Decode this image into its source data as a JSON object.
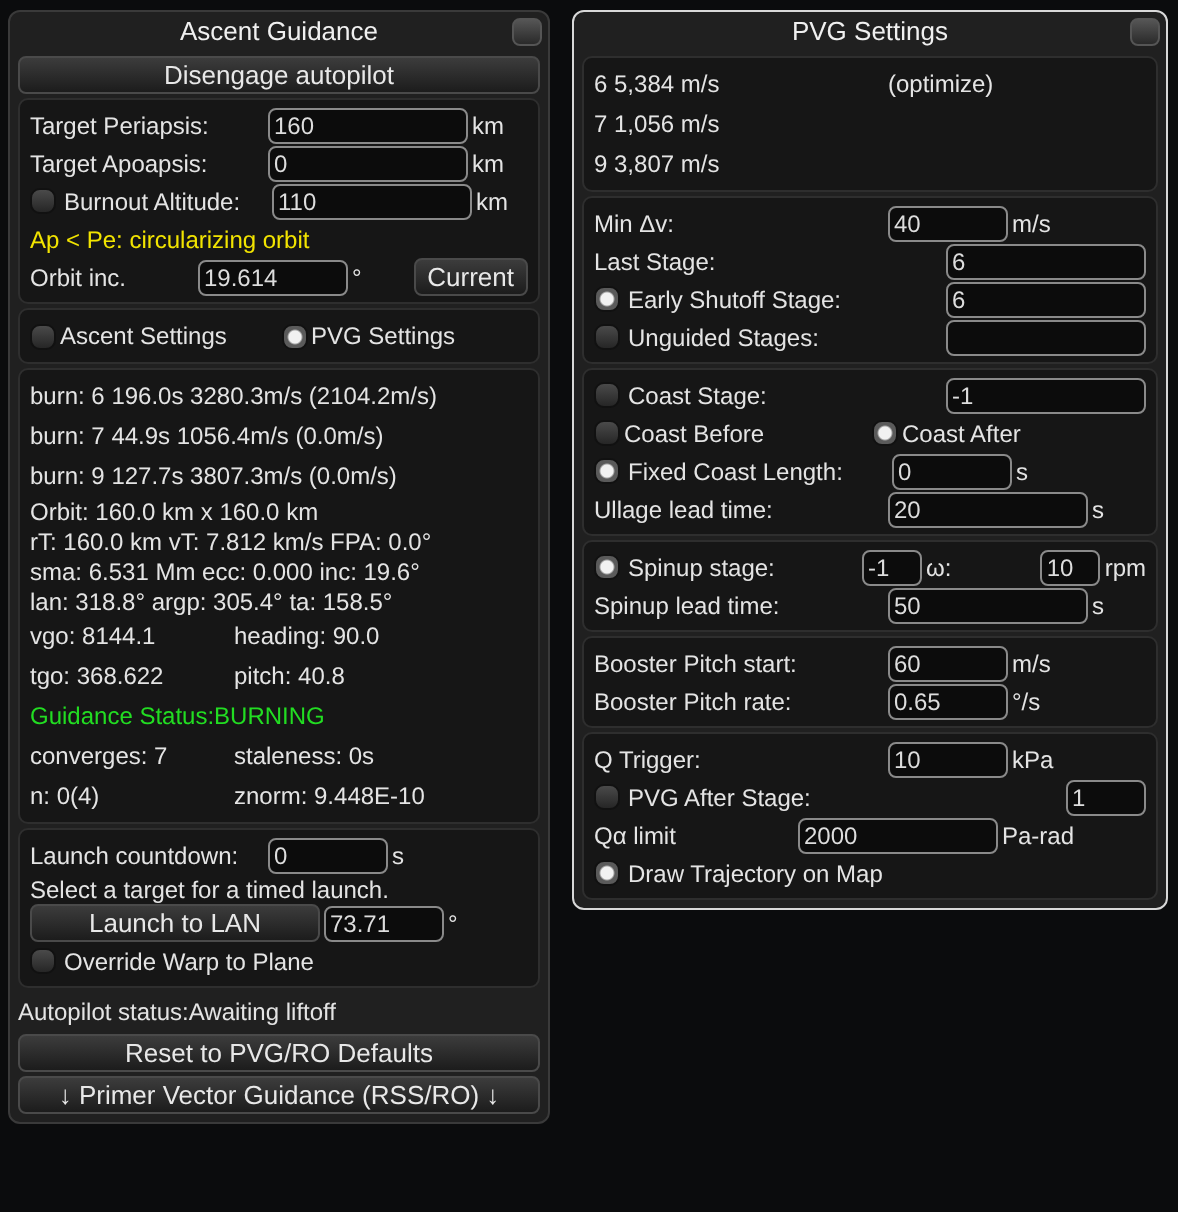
{
  "windows": [
    {
      "title": "Ascent Guidance",
      "blocks": [
        {
          "kind": "button",
          "label": "Disengage autopilot"
        },
        {
          "kind": "panel",
          "rows": [
            {
              "kind": "field",
              "label": "Target Periapsis:",
              "value": "160",
              "unit": "km"
            },
            {
              "kind": "field",
              "label": "Target Apoapsis:",
              "value": "0",
              "unit": "km"
            },
            {
              "kind": "field",
              "label": "Burnout Altitude:",
              "checked": false,
              "value": "110",
              "unit": "km"
            },
            {
              "kind": "warning",
              "text": "Ap < Pe: circularizing orbit"
            },
            {
              "kind": "field_button",
              "label": "Orbit inc.",
              "value": "19.614",
              "unit": "°",
              "button": "Current"
            }
          ]
        },
        {
          "kind": "panel",
          "rows": [
            {
              "kind": "tabs",
              "options": [
                {
                  "label": "Ascent Settings",
                  "selected": false
                },
                {
                  "label": "PVG Settings",
                  "selected": true
                }
              ]
            }
          ]
        },
        {
          "kind": "panel",
          "rows": [
            {
              "kind": "spaced",
              "text": "burn: 6 196.0s 3280.3m/s (2104.2m/s)"
            },
            {
              "kind": "spaced",
              "text": "burn: 7 44.9s 1056.4m/s (0.0m/s)"
            },
            {
              "kind": "spaced",
              "text": "burn: 9 127.7s 3807.3m/s (0.0m/s)"
            },
            {
              "kind": "text",
              "text": "Orbit: 160.0 km x 160.0 km"
            },
            {
              "kind": "text",
              "text": "rT: 160.0 km vT: 7.812 km/s FPA: 0.0°"
            },
            {
              "kind": "text",
              "text": "sma: 6.531 Mm ecc: 0.000 inc: 19.6°"
            },
            {
              "kind": "text",
              "text": "lan: 318.8° argp: 305.4° ta: 158.5°"
            },
            {
              "kind": "pair",
              "left": "vgo: 8144.1",
              "right": "heading: 90.0"
            },
            {
              "kind": "pair",
              "left": "tgo: 368.622",
              "right": "pitch: 40.8"
            },
            {
              "kind": "status",
              "text": "Guidance Status:BURNING"
            },
            {
              "kind": "pair",
              "left": "converges: 7",
              "right": "staleness: 0s"
            },
            {
              "kind": "pair",
              "left": "n: 0(4)",
              "right": "znorm: 9.448E-10"
            }
          ]
        },
        {
          "kind": "panel",
          "rows": [
            {
              "kind": "field_short",
              "label": "Launch countdown:",
              "value": "0",
              "unit": "s"
            },
            {
              "kind": "text",
              "text": "Select a target for a timed launch."
            },
            {
              "kind": "button_field",
              "button": "Launch to LAN",
              "value": "73.71",
              "unit": "°"
            },
            {
              "kind": "toggle",
              "label": "Override Warp to Plane",
              "checked": false
            }
          ]
        },
        {
          "kind": "text",
          "text": "Autopilot status:Awaiting liftoff"
        },
        {
          "kind": "button",
          "label": "Reset to PVG/RO Defaults"
        },
        {
          "kind": "button",
          "label": "↓ Primer Vector Guidance (RSS/RO) ↓"
        }
      ]
    },
    {
      "title": "PVG Settings",
      "blocks": [
        {
          "kind": "panel",
          "rows": [
            {
              "kind": "pair",
              "left": "6 5,384 m/s",
              "right": "(optimize)"
            },
            {
              "kind": "pair",
              "left": "7 1,056 m/s"
            },
            {
              "kind": "pair",
              "left": "9 3,807 m/s"
            }
          ]
        },
        {
          "kind": "panel",
          "rows": [
            {
              "kind": "field_short",
              "label": "Min Δv:",
              "value": "40",
              "unit": "m/s"
            },
            {
              "kind": "field_wide",
              "label": "Last Stage:",
              "value": "6"
            },
            {
              "kind": "field_wide",
              "label": "Early Shutoff Stage:",
              "checked": true,
              "value": "6"
            },
            {
              "kind": "field_wide",
              "label": "Unguided Stages:",
              "checked": false
            }
          ]
        },
        {
          "kind": "panel",
          "rows": [
            {
              "kind": "field_wide",
              "label": "Coast Stage:",
              "checked": false,
              "value": "-1"
            },
            {
              "kind": "radio_pair",
              "options": [
                {
                  "label": "Coast Before",
                  "checked": false
                },
                {
                  "label": "Coast After",
                  "checked": true
                }
              ]
            },
            {
              "kind": "field_short",
              "label": "Fixed Coast Length:",
              "checked": true,
              "value": "0",
              "unit": "s"
            },
            {
              "kind": "field",
              "label": "Ullage lead time:",
              "value": "20",
              "unit": "s"
            }
          ]
        },
        {
          "kind": "panel",
          "rows": [
            {
              "kind": "double_field",
              "label": "Spinup stage:",
              "checked": true,
              "value": "-1",
              "unit": "ω:",
              "value2": "10",
              "unit2": "rpm"
            },
            {
              "kind": "field",
              "label": "Spinup lead time:",
              "value": "50",
              "unit": "s"
            }
          ]
        },
        {
          "kind": "panel",
          "rows": [
            {
              "kind": "field_short",
              "label": "Booster Pitch start:",
              "value": "60",
              "unit": "m/s"
            },
            {
              "kind": "field_short",
              "label": "Booster Pitch rate:",
              "value": "0.65",
              "unit": "°/s"
            }
          ]
        },
        {
          "kind": "panel",
          "rows": [
            {
              "kind": "field_short",
              "label": "Q Trigger:",
              "value": "10",
              "unit": "kPa"
            },
            {
              "kind": "field_tiny",
              "label": "PVG After Stage:",
              "checked": false,
              "value": "1"
            },
            {
              "kind": "field_long",
              "label": "Qα limit",
              "value": "2000",
              "unit": "Pa-rad"
            },
            {
              "kind": "toggle",
              "label": "Draw Trajectory on Map",
              "checked": true
            }
          ]
        }
      ]
    }
  ]
}
